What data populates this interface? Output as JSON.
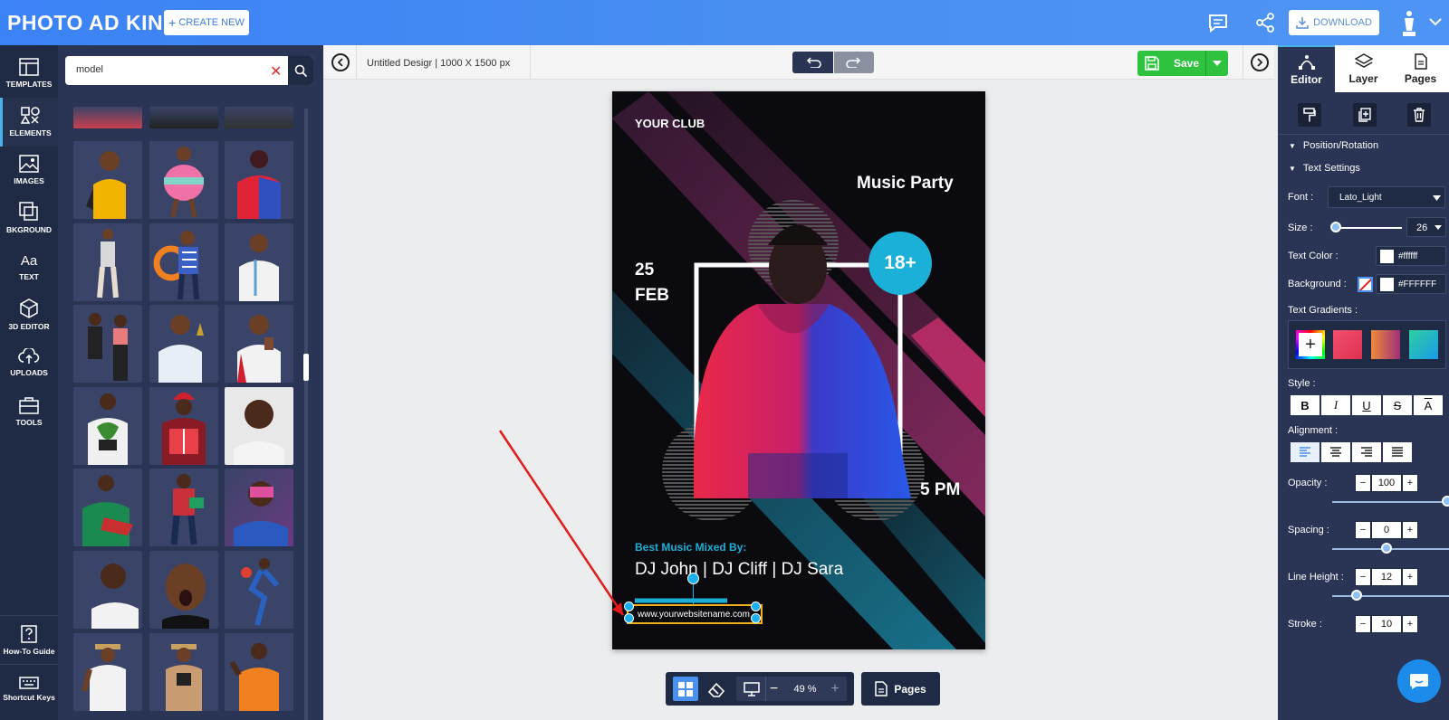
{
  "brand": {
    "logo_text": "PHOTO AD KING"
  },
  "topbar": {
    "create_label": "CREATE NEW",
    "download_label": "DOWNLOAD"
  },
  "leftnav": {
    "items": [
      {
        "label": "TEMPLATES",
        "icon": "templates-icon"
      },
      {
        "label": "ELEMENTS",
        "icon": "elements-icon"
      },
      {
        "label": "IMAGES",
        "icon": "images-icon"
      },
      {
        "label": "BKGROUND",
        "icon": "background-icon"
      },
      {
        "label": "TEXT",
        "icon": "text-icon"
      },
      {
        "label": "3D EDITOR",
        "icon": "3d-editor-icon"
      },
      {
        "label": "UPLOADS",
        "icon": "uploads-icon"
      },
      {
        "label": "TOOLS",
        "icon": "tools-icon"
      }
    ],
    "bottom": [
      {
        "label": "How-To Guide",
        "icon": "question-icon"
      },
      {
        "label": "Shortcut Keys",
        "icon": "keyboard-icon"
      }
    ]
  },
  "search": {
    "value": "model"
  },
  "canvas": {
    "doc_title": "Untitled Desigr",
    "doc_size": "1000 X 1500 px",
    "save_label": "Save",
    "zoom": "49 %",
    "pages_label": "Pages"
  },
  "poster": {
    "club": "YOUR CLUB",
    "event": "Music Party",
    "day": "25",
    "month": "FEB",
    "age": "18+",
    "time": "5 PM",
    "mixed_by": "Best Music Mixed By:",
    "djs": "DJ John | DJ Cliff | DJ Sara",
    "website": "www.yourwebsitename.com"
  },
  "rightpanel": {
    "tabs": [
      "Editor",
      "Layer",
      "Pages"
    ],
    "section_position": "Position/Rotation",
    "section_text": "Text Settings",
    "font_label": "Font :",
    "font_value": "Lato_Light",
    "size_label": "Size :",
    "size_value": "26",
    "text_color_label": "Text Color :",
    "text_color_value": "#ffffff",
    "background_label": "Background :",
    "background_value": "#FFFFFF",
    "gradients_label": "Text Gradients :",
    "style_label": "Style :",
    "alignment_label": "Alignment :",
    "opacity_label": "Opacity :",
    "opacity_value": "100",
    "spacing_label": "Spacing :",
    "spacing_value": "0",
    "line_height_label": "Line Height :",
    "line_height_value": "12",
    "stroke_label": "Stroke :",
    "stroke_value": "10"
  },
  "colors": {
    "accent": "#4ab0e8",
    "save_green": "#2ec23e",
    "nav_bg": "#1f2a44",
    "panel_bg": "#2a3454"
  }
}
